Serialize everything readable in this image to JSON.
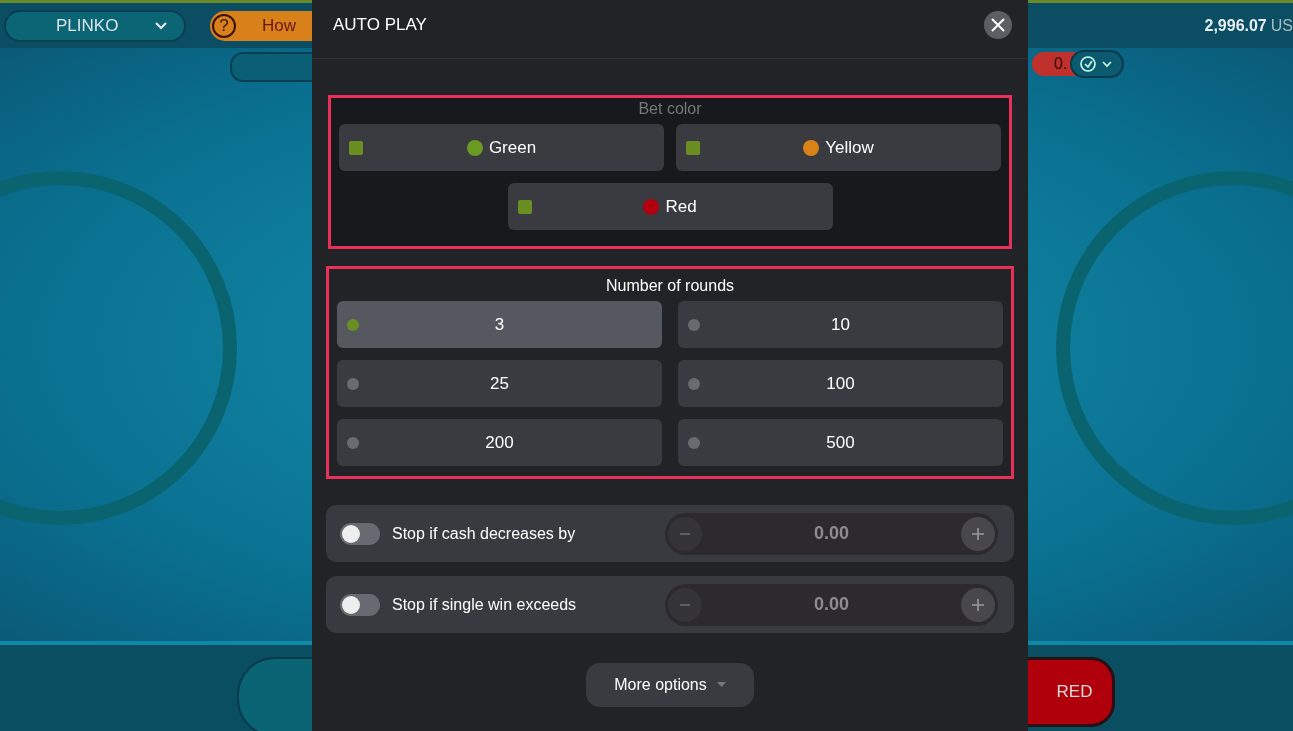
{
  "game_select": {
    "label": "PLINKO"
  },
  "how_to_play": {
    "icon": "?",
    "label": "How"
  },
  "balance": {
    "amount": "2,996.07",
    "currency": "US"
  },
  "last_win": {
    "value": "0."
  },
  "bet_button": {
    "label": "RED"
  },
  "dialog": {
    "title": "AUTO PLAY",
    "bet_color": {
      "title": "Bet color",
      "highlighted": true,
      "options": [
        {
          "label": "Green",
          "color": "#6b9a22",
          "checked": true
        },
        {
          "label": "Yellow",
          "color": "#d98218",
          "checked": true
        },
        {
          "label": "Red",
          "color": "#b00010",
          "checked": true
        }
      ]
    },
    "rounds": {
      "title": "Number of rounds",
      "highlighted": true,
      "options": [
        {
          "label": "3",
          "selected": true
        },
        {
          "label": "10",
          "selected": false
        },
        {
          "label": "25",
          "selected": false
        },
        {
          "label": "100",
          "selected": false
        },
        {
          "label": "200",
          "selected": false
        },
        {
          "label": "500",
          "selected": false
        }
      ]
    },
    "stop_conditions": [
      {
        "label": "Stop if cash decreases by",
        "on": false,
        "value": "0.00"
      },
      {
        "label": "Stop if single win exceeds",
        "on": false,
        "value": "0.00"
      }
    ],
    "more_options": {
      "label": "More options"
    }
  }
}
